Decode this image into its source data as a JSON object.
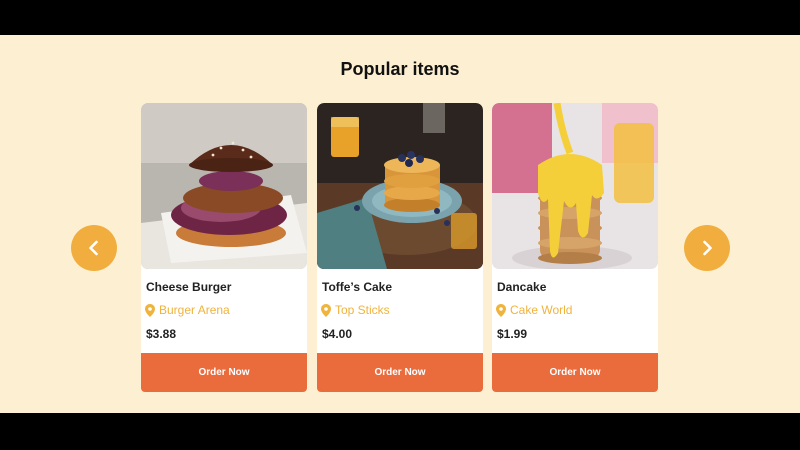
{
  "section": {
    "title": "Popular items",
    "background_color": "#fdf0d2",
    "accent_color": "#f1ae3e",
    "button_color": "#ea6b3b"
  },
  "carousel": {
    "prev_icon": "chevron-left-icon",
    "next_icon": "chevron-right-icon"
  },
  "items": [
    {
      "name": "Cheese Burger",
      "restaurant": "Burger Arena",
      "price": "$3.88",
      "order_label": "Order Now",
      "image": "burger-photo"
    },
    {
      "name": "Toffe’s Cake",
      "restaurant": "Top Sticks",
      "price": "$4.00",
      "order_label": "Order Now",
      "image": "pancakes-photo"
    },
    {
      "name": "Dancake",
      "restaurant": "Cake World",
      "price": "$1.99",
      "order_label": "Order Now",
      "image": "syrup-pancakes-photo"
    }
  ]
}
